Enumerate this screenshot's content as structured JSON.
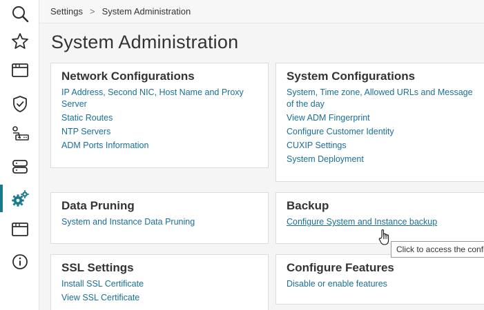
{
  "breadcrumb": {
    "parent": "Settings",
    "separator": ">",
    "current": "System Administration"
  },
  "page": {
    "title": "System Administration"
  },
  "sidebar": {
    "items": [
      {
        "name": "search",
        "icon": "search-icon"
      },
      {
        "name": "favorites",
        "icon": "star-icon"
      },
      {
        "name": "window",
        "icon": "window-icon"
      },
      {
        "name": "security",
        "icon": "shield-icon"
      },
      {
        "name": "network",
        "icon": "network-device-icon"
      },
      {
        "name": "infrastructure",
        "icon": "server-icon"
      },
      {
        "name": "settings",
        "icon": "gears-icon",
        "active": true
      },
      {
        "name": "applications",
        "icon": "window-icon"
      },
      {
        "name": "info",
        "icon": "info-icon"
      }
    ]
  },
  "cards": {
    "network": {
      "title": "Network Configurations",
      "links": [
        "IP Address, Second NIC, Host Name and Proxy Server",
        "Static Routes",
        "NTP Servers",
        "ADM Ports Information"
      ]
    },
    "system": {
      "title": "System Configurations",
      "links": [
        "System, Time zone, Allowed URLs and Message of the day",
        "View ADM Fingerprint",
        "Configure Customer Identity",
        "CUXIP Settings",
        "System Deployment"
      ]
    },
    "pruning": {
      "title": "Data Pruning",
      "links": [
        "System and Instance Data Pruning"
      ]
    },
    "backup": {
      "title": "Backup",
      "links": [
        "Configure System and Instance backup"
      ]
    },
    "ssl": {
      "title": "SSL Settings",
      "links": [
        "Install SSL Certificate",
        "View SSL Certificate"
      ]
    },
    "features": {
      "title": "Configure Features",
      "links": [
        "Disable or enable features"
      ]
    }
  },
  "tooltip": {
    "text": "Click to access the confi"
  },
  "colors": {
    "accent": "#1a7a8c",
    "link": "#1a6f96",
    "icon": "#2b2b2b"
  }
}
